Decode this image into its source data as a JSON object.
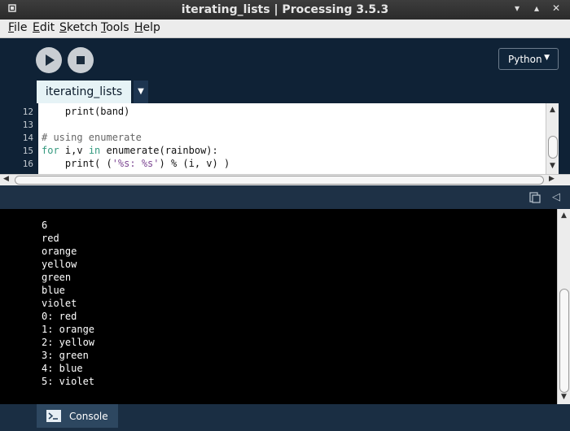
{
  "window": {
    "title": "iterating_lists | Processing 3.5.3",
    "controls": {
      "minimize": "▾",
      "maximize": "▴",
      "close": "✕"
    }
  },
  "menu": {
    "items": [
      {
        "label": "File",
        "mnemonic": "F",
        "rest": "ile"
      },
      {
        "label": "Edit",
        "mnemonic": "E",
        "rest": "dit"
      },
      {
        "label": "Sketch",
        "mnemonic": "S",
        "rest": "ketch"
      },
      {
        "label": "Tools",
        "mnemonic": "T",
        "rest": "ools"
      },
      {
        "label": "Help",
        "mnemonic": "H",
        "rest": "elp"
      }
    ]
  },
  "toolbar": {
    "run_icon": "play-icon",
    "stop_icon": "stop-icon",
    "mode_label": "Python",
    "mode_arrow": "▼"
  },
  "tabs": [
    {
      "label": "iterating_lists",
      "active": true
    }
  ],
  "tab_menu_arrow": "▼",
  "editor": {
    "line_numbers": [
      "12",
      "13",
      "14",
      "15",
      "16"
    ],
    "lines": [
      [
        {
          "t": "    print(band)",
          "c": ""
        }
      ],
      [
        {
          "t": "",
          "c": ""
        }
      ],
      [
        {
          "t": "# using enumerate",
          "c": "cm"
        }
      ],
      [
        {
          "t": "for",
          "c": "kw"
        },
        {
          "t": " i,v ",
          "c": ""
        },
        {
          "t": "in",
          "c": "kw"
        },
        {
          "t": " enumerate(rainbow):",
          "c": ""
        }
      ],
      [
        {
          "t": "    print( (",
          "c": ""
        },
        {
          "t": "'%s: %s'",
          "c": "st"
        },
        {
          "t": ") % (i, v) )",
          "c": ""
        }
      ]
    ]
  },
  "console": {
    "lines": [
      "6",
      "red",
      "orange",
      "yellow",
      "green",
      "blue",
      "violet",
      "0: red",
      "1: orange",
      "2: yellow",
      "3: green",
      "4: blue",
      "5: violet"
    ]
  },
  "footer": {
    "console_tab_label": "Console"
  },
  "colors": {
    "background": "#0b1b2b",
    "keyword": "#33997e",
    "comment": "#666666",
    "string": "#7d4793",
    "console_bg": "#000000",
    "tab_active": "#e6f3f6"
  }
}
